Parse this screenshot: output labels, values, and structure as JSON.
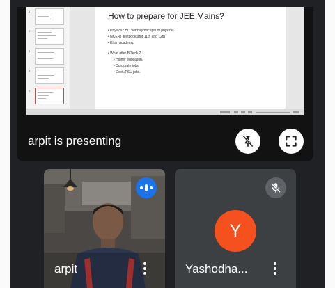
{
  "slide": {
    "title": "How to prepare for JEE Mains?",
    "bullets": [
      "Physics : HC Verma(concepts of physics)",
      "NCERT textbooks(for 11th and 12th",
      "Khan academy."
    ],
    "question": "What after B.Tech.?",
    "sub_bullets": [
      "Higher education.",
      "Corporate jobs.",
      "Govt./PSU jobs."
    ],
    "thumbnail_numbers": [
      "1",
      "2",
      "3",
      "4",
      "5"
    ]
  },
  "presentation": {
    "presenter_text": "arpit is presenting",
    "unpin_icon": "pin-off-icon",
    "fullscreen_icon": "fullscreen-icon"
  },
  "participants": [
    {
      "name": "arpit",
      "speaking": true,
      "speaking_icon": "audio-level-icon",
      "menu_icon": "more-vert-icon"
    },
    {
      "name": "Yashodha...",
      "initial": "Y",
      "avatar_color": "#f4511e",
      "mic_icon": "mic-off-icon",
      "menu_icon": "more-vert-icon"
    }
  ],
  "colors": {
    "background": "#202124",
    "speaking_indicator": "#1a73e8",
    "avatar": "#f4511e"
  }
}
